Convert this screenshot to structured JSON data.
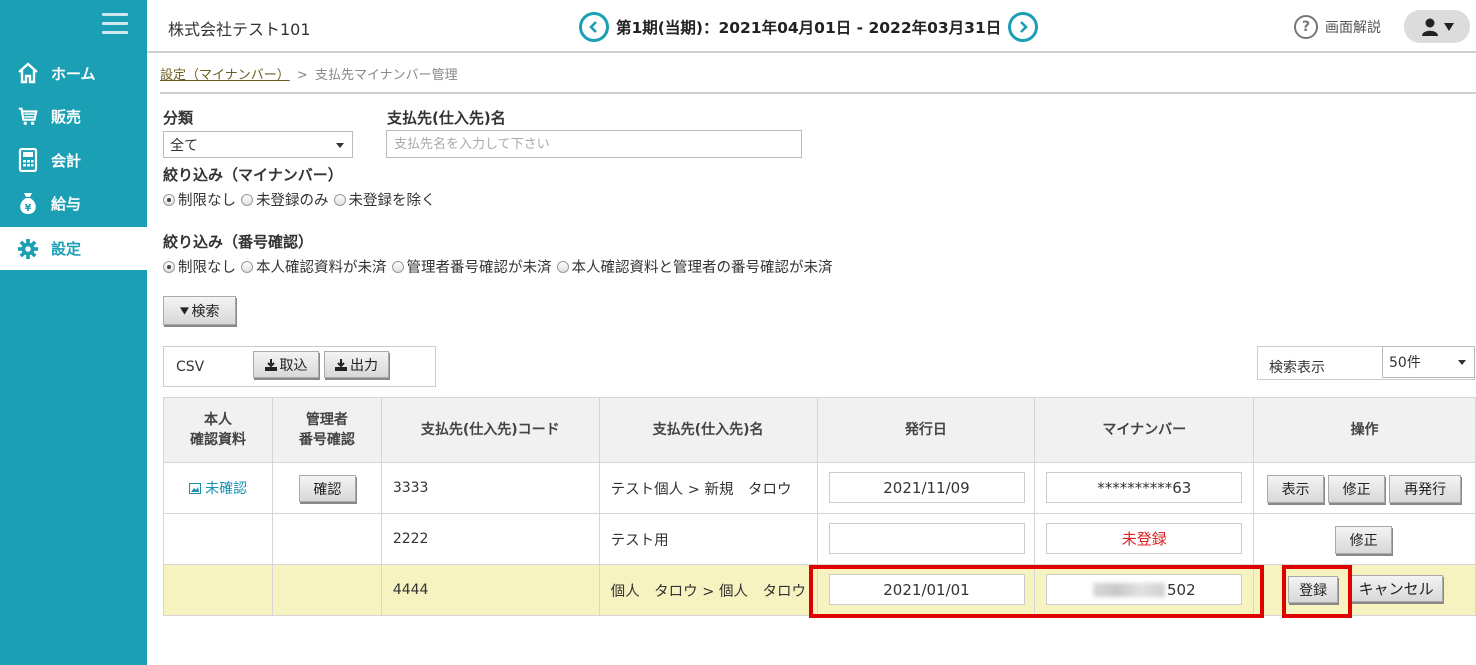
{
  "sidebar": {
    "items": [
      {
        "label": "ホーム",
        "icon": "home-icon"
      },
      {
        "label": "販売",
        "icon": "cart-icon"
      },
      {
        "label": "会計",
        "icon": "calculator-icon"
      },
      {
        "label": "給与",
        "icon": "money-bag-icon"
      },
      {
        "label": "設定",
        "icon": "gear-icon"
      }
    ],
    "active": "設定"
  },
  "header": {
    "company": "株式会社テスト101",
    "period": "第1期(当期)：2021年04月01日 - 2022年03月31日",
    "help": "画面解説"
  },
  "breadcrumb": {
    "parent": "設定（マイナンバー）",
    "sep": ">",
    "current": "支払先マイナンバー管理"
  },
  "filters": {
    "category_label": "分類",
    "category_value": "全て",
    "name_label": "支払先(仕入先)名",
    "name_placeholder": "支払先名を入力して下さい",
    "mynumber_label": "絞り込み（マイナンバー）",
    "mynumber_options": [
      "制限なし",
      "未登録のみ",
      "未登録を除く"
    ],
    "verify_label": "絞り込み（番号確認）",
    "verify_options": [
      "制限なし",
      "本人確認資料が未済",
      "管理者番号確認が未済",
      "本人確認資料と管理者の番号確認が未済"
    ],
    "search_button": "検索"
  },
  "csv": {
    "label": "CSV",
    "import": "取込",
    "export": "出力"
  },
  "display": {
    "label": "検索表示",
    "value": "50件"
  },
  "table": {
    "headers": [
      "本人\n確認資料",
      "管理者\n番号確認",
      "支払先(仕入先)コード",
      "支払先(仕入先)名",
      "発行日",
      "マイナンバー",
      "操作"
    ],
    "rows": [
      {
        "id_doc": "未確認",
        "admin_btn": "確認",
        "code": "3333",
        "name": "テスト個人 > 新規　タロウ",
        "issued": "2021/11/09",
        "mynumber": "**********63",
        "actions": [
          "表示",
          "修正",
          "再発行"
        ]
      },
      {
        "id_doc": "",
        "admin_btn": "",
        "code": "2222",
        "name": "テスト用",
        "issued": "",
        "mynumber": "未登録",
        "actions": [
          "修正"
        ]
      },
      {
        "id_doc": "",
        "admin_btn": "",
        "code": "4444",
        "name": "個人　タロウ > 個人　タロウ",
        "issued": "2021/01/01",
        "mynumber": "502",
        "actions": [
          "登録",
          "キャンセル"
        ]
      }
    ]
  },
  "colors": {
    "sidebar": "#1a9fb5",
    "highlight_row": "#f7f3c0",
    "unregistered": "#e02020",
    "annotation": "#e00000"
  }
}
